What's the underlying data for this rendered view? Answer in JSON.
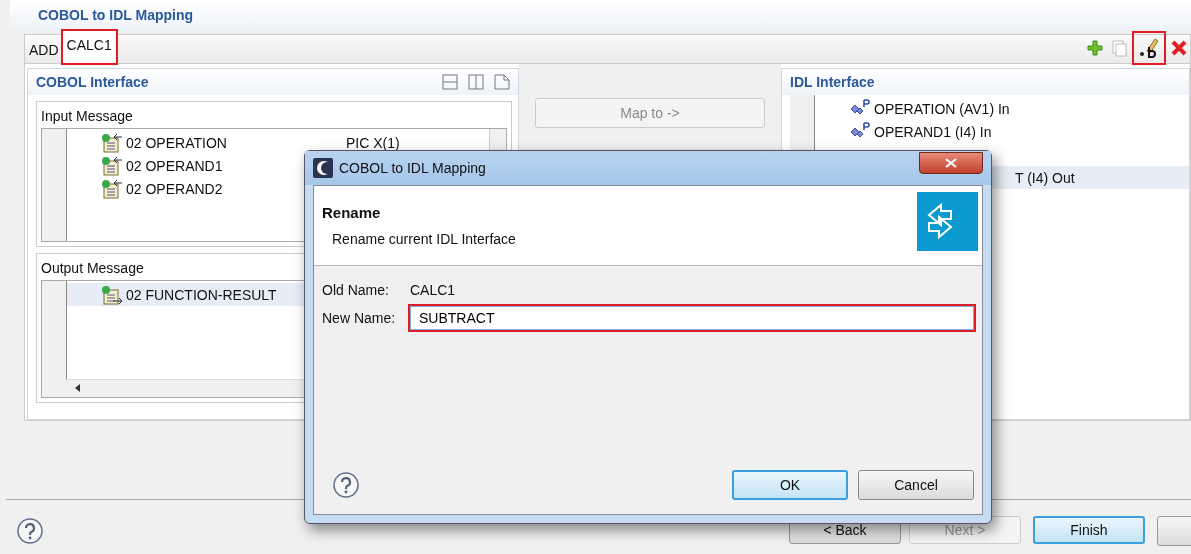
{
  "page": {
    "title": "COBOL to IDL Mapping"
  },
  "tabs": [
    {
      "label": "ADD",
      "selected": false
    },
    {
      "label": "CALC1",
      "selected": true
    }
  ],
  "cobol_interface": {
    "title": "COBOL Interface",
    "input_message": {
      "title": "Input Message",
      "rows": [
        {
          "name": "02 OPERATION",
          "type": "PIC X(1)"
        },
        {
          "name": "02 OPERAND1"
        },
        {
          "name": "02 OPERAND2"
        }
      ]
    },
    "output_message": {
      "title": "Output Message",
      "rows": [
        {
          "name": "02 FUNCTION-RESULT",
          "selected": true
        }
      ]
    }
  },
  "map_button": {
    "label": "Map to ->",
    "disabled": true
  },
  "idl_interface": {
    "title": "IDL Interface",
    "items": [
      {
        "kind": "param",
        "text": "OPERATION  (AV1)  In",
        "selected": false
      },
      {
        "kind": "param",
        "text": "OPERAND1  (I4)  In",
        "selected": false
      },
      {
        "kind": "clipped",
        "text": "T  (I4)  Out",
        "selected": true
      }
    ]
  },
  "wizard_buttons": [
    {
      "label": "< Back",
      "disabled": false,
      "default": false
    },
    {
      "label": "Next >",
      "disabled": true,
      "default": false
    },
    {
      "label": "Finish",
      "disabled": false,
      "default": true
    }
  ],
  "dialog": {
    "title": "COBOL to IDL Mapping",
    "heading": "Rename",
    "description": "Rename current IDL Interface",
    "old_name_label": "Old Name:",
    "old_name": "CALC1",
    "new_name_label": "New Name:",
    "new_name": "SUBTRACT",
    "buttons": [
      {
        "label": "OK",
        "default": true
      },
      {
        "label": "Cancel",
        "default": false
      }
    ]
  }
}
